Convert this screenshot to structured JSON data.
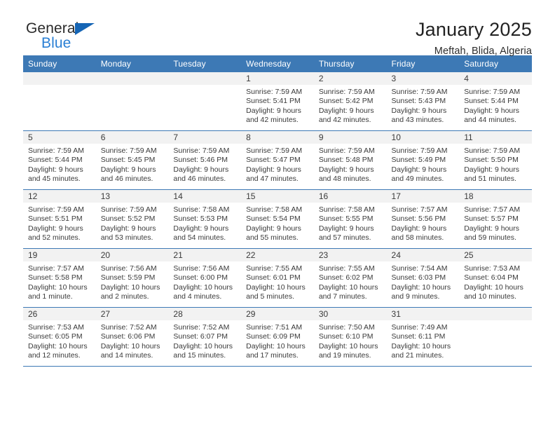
{
  "brand": {
    "name_top": "General",
    "name_bottom": "Blue",
    "triangle_color": "#1565b5",
    "blue_text_color": "#2a7fd4"
  },
  "header": {
    "title": "January 2025",
    "subtitle": "Meftah, Blida, Algeria"
  },
  "theme": {
    "header_blue": "#3d79b5",
    "daynum_band": "#f2f2f2",
    "row_separator": "#3d79b5",
    "text": "#3a3a3a"
  },
  "weekday_headers": [
    "Sunday",
    "Monday",
    "Tuesday",
    "Wednesday",
    "Thursday",
    "Friday",
    "Saturday"
  ],
  "labels": {
    "sunrise_prefix": "Sunrise:",
    "sunset_prefix": "Sunset:",
    "daylight_prefix": "Daylight:"
  },
  "weeks": [
    [
      {
        "day": "",
        "empty": true
      },
      {
        "day": "",
        "empty": true
      },
      {
        "day": "",
        "empty": true
      },
      {
        "day": "1",
        "sunrise": "Sunrise: 7:59 AM",
        "sunset": "Sunset: 5:41 PM",
        "daylight": "Daylight: 9 hours and 42 minutes."
      },
      {
        "day": "2",
        "sunrise": "Sunrise: 7:59 AM",
        "sunset": "Sunset: 5:42 PM",
        "daylight": "Daylight: 9 hours and 42 minutes."
      },
      {
        "day": "3",
        "sunrise": "Sunrise: 7:59 AM",
        "sunset": "Sunset: 5:43 PM",
        "daylight": "Daylight: 9 hours and 43 minutes."
      },
      {
        "day": "4",
        "sunrise": "Sunrise: 7:59 AM",
        "sunset": "Sunset: 5:44 PM",
        "daylight": "Daylight: 9 hours and 44 minutes."
      }
    ],
    [
      {
        "day": "5",
        "sunrise": "Sunrise: 7:59 AM",
        "sunset": "Sunset: 5:44 PM",
        "daylight": "Daylight: 9 hours and 45 minutes."
      },
      {
        "day": "6",
        "sunrise": "Sunrise: 7:59 AM",
        "sunset": "Sunset: 5:45 PM",
        "daylight": "Daylight: 9 hours and 46 minutes."
      },
      {
        "day": "7",
        "sunrise": "Sunrise: 7:59 AM",
        "sunset": "Sunset: 5:46 PM",
        "daylight": "Daylight: 9 hours and 46 minutes."
      },
      {
        "day": "8",
        "sunrise": "Sunrise: 7:59 AM",
        "sunset": "Sunset: 5:47 PM",
        "daylight": "Daylight: 9 hours and 47 minutes."
      },
      {
        "day": "9",
        "sunrise": "Sunrise: 7:59 AM",
        "sunset": "Sunset: 5:48 PM",
        "daylight": "Daylight: 9 hours and 48 minutes."
      },
      {
        "day": "10",
        "sunrise": "Sunrise: 7:59 AM",
        "sunset": "Sunset: 5:49 PM",
        "daylight": "Daylight: 9 hours and 49 minutes."
      },
      {
        "day": "11",
        "sunrise": "Sunrise: 7:59 AM",
        "sunset": "Sunset: 5:50 PM",
        "daylight": "Daylight: 9 hours and 51 minutes."
      }
    ],
    [
      {
        "day": "12",
        "sunrise": "Sunrise: 7:59 AM",
        "sunset": "Sunset: 5:51 PM",
        "daylight": "Daylight: 9 hours and 52 minutes."
      },
      {
        "day": "13",
        "sunrise": "Sunrise: 7:59 AM",
        "sunset": "Sunset: 5:52 PM",
        "daylight": "Daylight: 9 hours and 53 minutes."
      },
      {
        "day": "14",
        "sunrise": "Sunrise: 7:58 AM",
        "sunset": "Sunset: 5:53 PM",
        "daylight": "Daylight: 9 hours and 54 minutes."
      },
      {
        "day": "15",
        "sunrise": "Sunrise: 7:58 AM",
        "sunset": "Sunset: 5:54 PM",
        "daylight": "Daylight: 9 hours and 55 minutes."
      },
      {
        "day": "16",
        "sunrise": "Sunrise: 7:58 AM",
        "sunset": "Sunset: 5:55 PM",
        "daylight": "Daylight: 9 hours and 57 minutes."
      },
      {
        "day": "17",
        "sunrise": "Sunrise: 7:57 AM",
        "sunset": "Sunset: 5:56 PM",
        "daylight": "Daylight: 9 hours and 58 minutes."
      },
      {
        "day": "18",
        "sunrise": "Sunrise: 7:57 AM",
        "sunset": "Sunset: 5:57 PM",
        "daylight": "Daylight: 9 hours and 59 minutes."
      }
    ],
    [
      {
        "day": "19",
        "sunrise": "Sunrise: 7:57 AM",
        "sunset": "Sunset: 5:58 PM",
        "daylight": "Daylight: 10 hours and 1 minute."
      },
      {
        "day": "20",
        "sunrise": "Sunrise: 7:56 AM",
        "sunset": "Sunset: 5:59 PM",
        "daylight": "Daylight: 10 hours and 2 minutes."
      },
      {
        "day": "21",
        "sunrise": "Sunrise: 7:56 AM",
        "sunset": "Sunset: 6:00 PM",
        "daylight": "Daylight: 10 hours and 4 minutes."
      },
      {
        "day": "22",
        "sunrise": "Sunrise: 7:55 AM",
        "sunset": "Sunset: 6:01 PM",
        "daylight": "Daylight: 10 hours and 5 minutes."
      },
      {
        "day": "23",
        "sunrise": "Sunrise: 7:55 AM",
        "sunset": "Sunset: 6:02 PM",
        "daylight": "Daylight: 10 hours and 7 minutes."
      },
      {
        "day": "24",
        "sunrise": "Sunrise: 7:54 AM",
        "sunset": "Sunset: 6:03 PM",
        "daylight": "Daylight: 10 hours and 9 minutes."
      },
      {
        "day": "25",
        "sunrise": "Sunrise: 7:53 AM",
        "sunset": "Sunset: 6:04 PM",
        "daylight": "Daylight: 10 hours and 10 minutes."
      }
    ],
    [
      {
        "day": "26",
        "sunrise": "Sunrise: 7:53 AM",
        "sunset": "Sunset: 6:05 PM",
        "daylight": "Daylight: 10 hours and 12 minutes."
      },
      {
        "day": "27",
        "sunrise": "Sunrise: 7:52 AM",
        "sunset": "Sunset: 6:06 PM",
        "daylight": "Daylight: 10 hours and 14 minutes."
      },
      {
        "day": "28",
        "sunrise": "Sunrise: 7:52 AM",
        "sunset": "Sunset: 6:07 PM",
        "daylight": "Daylight: 10 hours and 15 minutes."
      },
      {
        "day": "29",
        "sunrise": "Sunrise: 7:51 AM",
        "sunset": "Sunset: 6:09 PM",
        "daylight": "Daylight: 10 hours and 17 minutes."
      },
      {
        "day": "30",
        "sunrise": "Sunrise: 7:50 AM",
        "sunset": "Sunset: 6:10 PM",
        "daylight": "Daylight: 10 hours and 19 minutes."
      },
      {
        "day": "31",
        "sunrise": "Sunrise: 7:49 AM",
        "sunset": "Sunset: 6:11 PM",
        "daylight": "Daylight: 10 hours and 21 minutes."
      },
      {
        "day": "",
        "empty": true
      }
    ]
  ]
}
